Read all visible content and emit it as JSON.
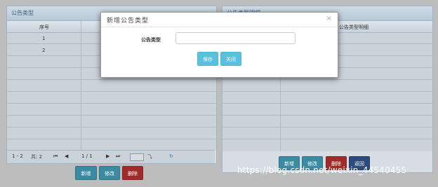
{
  "left_panel": {
    "title": "公告类型",
    "columns": [
      "序号"
    ],
    "rows": [
      {
        "index": "1"
      },
      {
        "index": "2"
      }
    ]
  },
  "pager": {
    "range": "1 - 2",
    "total": "共: 2",
    "page": "1 / 1",
    "first_icon": "first-page-icon",
    "prev_icon": "prev-page-icon",
    "next_icon": "next-page-icon",
    "last_icon": "last-page-icon",
    "go_icon": "go-arrow-icon",
    "refresh_icon": "refresh-icon"
  },
  "left_buttons": {
    "add": "新增",
    "edit": "修改",
    "delete": "删除"
  },
  "right_panel": {
    "title": "公告类型明细",
    "column": "公告类型明细"
  },
  "right_buttons": {
    "add": "新增",
    "edit": "修改",
    "delete": "删除",
    "back": "返回"
  },
  "dialog": {
    "title": "新增公告类型",
    "close": "×",
    "field_label": "公告类型",
    "field_value": "",
    "save": "保存",
    "close_button": "关闭"
  },
  "watermark": "https://blog.csdn.net/weixin_44540455",
  "colors": {
    "overlay": "#bdbdbd",
    "panel_title": "#39607d",
    "button_teal": "#3a8aa1",
    "button_red": "#a02b2b",
    "button_blue": "#2b4b7d",
    "dialog_button": "#5bc0de"
  }
}
